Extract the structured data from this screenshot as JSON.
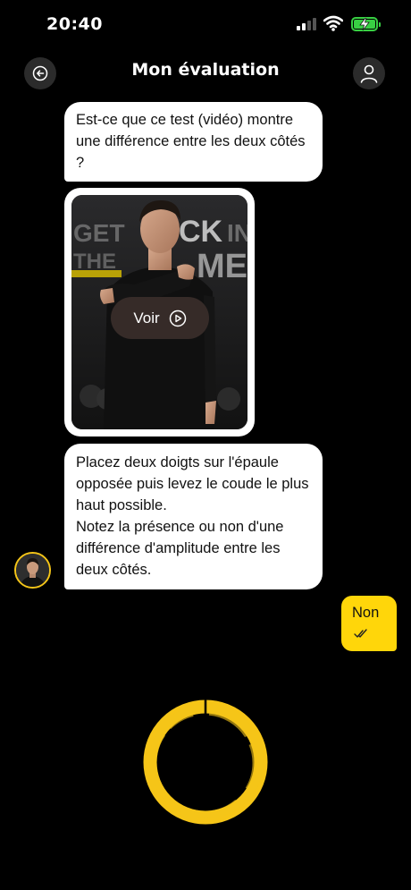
{
  "status_bar": {
    "time": "20:40",
    "signal_icon": "signal-icon",
    "wifi_icon": "wifi-icon",
    "battery_icon": "battery-charging-icon",
    "battery_color": "#38d043"
  },
  "header": {
    "title": "Mon évaluation",
    "back_icon": "back-arrow-icon",
    "profile_icon": "user-icon"
  },
  "messages": {
    "question": "Est-ce que ce test (vidéo) montre une différence entre les deux côtés ?",
    "video": {
      "play_label": "Voir",
      "background_text_top": "GET BACK IN",
      "background_text_bottom": "THE GAME"
    },
    "instruction_1": "Placez deux doigts sur l'épaule opposée puis levez le coude le plus haut possible.",
    "instruction_2": "Notez la présence ou non d'une différence d'amplitude entre les deux côtés.",
    "answer": "Non"
  },
  "colors": {
    "background": "#000000",
    "bubble": "#ffffff",
    "accent": "#ffd60a"
  }
}
